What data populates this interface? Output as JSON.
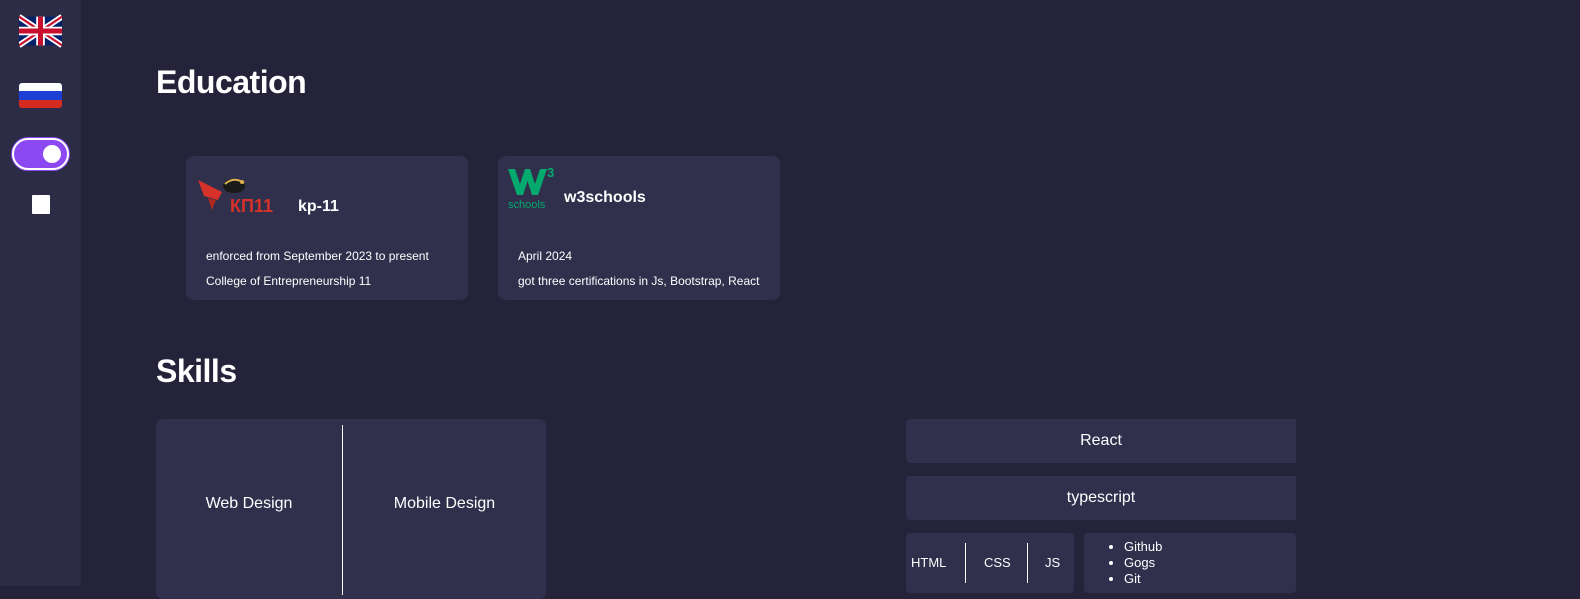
{
  "sidebar": {
    "flags": [
      "uk-flag-icon",
      "ru-flag-icon"
    ],
    "theme_toggle": {
      "state": "on",
      "accent": "#8c49f2"
    },
    "checkbox": {
      "checked": false
    }
  },
  "education": {
    "title": "Education",
    "cards": [
      {
        "logo_text": "КП11",
        "name": "kp-11",
        "period": "enforced from September 2023 to present",
        "description": "College of Entrepreneurship 11"
      },
      {
        "logo_text": "schools",
        "logo_sup": "3",
        "name": "w3schools",
        "period": "April 2024",
        "description": "got three certifications in Js, Bootstrap, React"
      }
    ]
  },
  "skills": {
    "title": "Skills",
    "design": [
      "Web Design",
      "Mobile Design"
    ],
    "tech": [
      "React",
      "typescript"
    ],
    "languages": [
      "HTML",
      "CSS",
      "JS"
    ],
    "tools": [
      "Github",
      "Gogs",
      "Git"
    ]
  },
  "colors": {
    "background": "#24233a",
    "sidebar": "#2d2c47",
    "card": "#302f4c",
    "accent": "#8c49f2",
    "kp_red": "#d7322a",
    "w3_green": "#04aa6d"
  }
}
